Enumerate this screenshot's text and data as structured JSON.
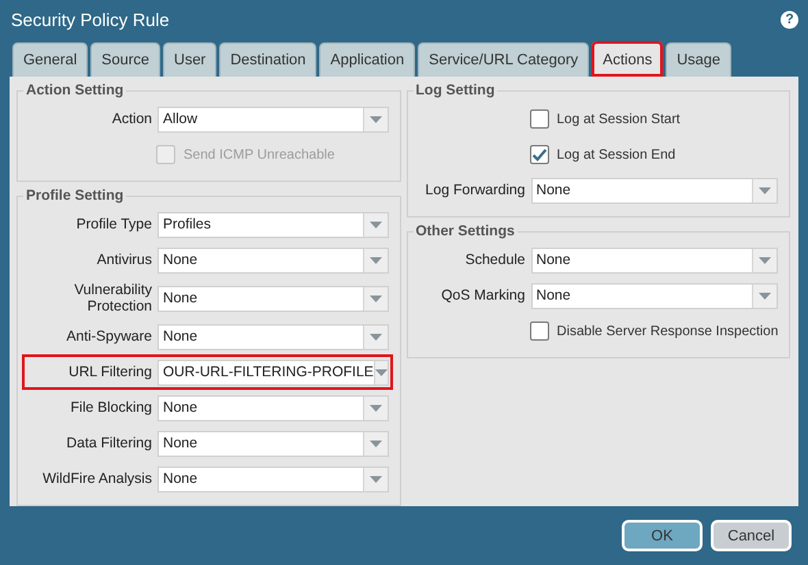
{
  "window": {
    "title": "Security Policy Rule",
    "help": "?"
  },
  "tabs": [
    {
      "label": "General",
      "selected": false,
      "highlighted": false
    },
    {
      "label": "Source",
      "selected": false,
      "highlighted": false
    },
    {
      "label": "User",
      "selected": false,
      "highlighted": false
    },
    {
      "label": "Destination",
      "selected": false,
      "highlighted": false
    },
    {
      "label": "Application",
      "selected": false,
      "highlighted": false
    },
    {
      "label": "Service/URL Category",
      "selected": false,
      "highlighted": false
    },
    {
      "label": "Actions",
      "selected": true,
      "highlighted": true
    },
    {
      "label": "Usage",
      "selected": false,
      "highlighted": false
    }
  ],
  "left_sections": [
    {
      "title": "Action Setting",
      "rows": [
        {
          "kind": "select",
          "label": "Action",
          "value": "Allow",
          "highlighted": false
        },
        {
          "kind": "checkbox",
          "label": "Send ICMP Unreachable",
          "checked": false,
          "disabled": true
        }
      ]
    },
    {
      "title": "Profile Setting",
      "rows": [
        {
          "kind": "select",
          "label": "Profile Type",
          "value": "Profiles",
          "highlighted": false
        },
        {
          "kind": "select",
          "label": "Antivirus",
          "value": "None",
          "highlighted": false
        },
        {
          "kind": "select",
          "label": "Vulnerability Protection",
          "value": "None",
          "highlighted": false
        },
        {
          "kind": "select",
          "label": "Anti-Spyware",
          "value": "None",
          "highlighted": false
        },
        {
          "kind": "select",
          "label": "URL Filtering",
          "value": "OUR-URL-FILTERING-PROFILE",
          "highlighted": true
        },
        {
          "kind": "select",
          "label": "File Blocking",
          "value": "None",
          "highlighted": false
        },
        {
          "kind": "select",
          "label": "Data Filtering",
          "value": "None",
          "highlighted": false
        },
        {
          "kind": "select",
          "label": "WildFire Analysis",
          "value": "None",
          "highlighted": false
        }
      ]
    }
  ],
  "right_sections": [
    {
      "title": "Log Setting",
      "rows": [
        {
          "kind": "checkbox",
          "label": "Log at Session Start",
          "checked": false,
          "disabled": false
        },
        {
          "kind": "checkbox",
          "label": "Log at Session End",
          "checked": true,
          "disabled": false
        },
        {
          "kind": "select",
          "label": "Log Forwarding",
          "value": "None",
          "highlighted": false
        }
      ]
    },
    {
      "title": "Other Settings",
      "rows": [
        {
          "kind": "select",
          "label": "Schedule",
          "value": "None",
          "highlighted": false
        },
        {
          "kind": "select",
          "label": "QoS Marking",
          "value": "None",
          "highlighted": false
        },
        {
          "kind": "checkbox",
          "label": "Disable Server Response Inspection",
          "checked": false,
          "disabled": false
        }
      ]
    }
  ],
  "buttons": [
    {
      "label": "OK",
      "kind": "primary"
    },
    {
      "label": "Cancel",
      "kind": "secondary"
    }
  ]
}
